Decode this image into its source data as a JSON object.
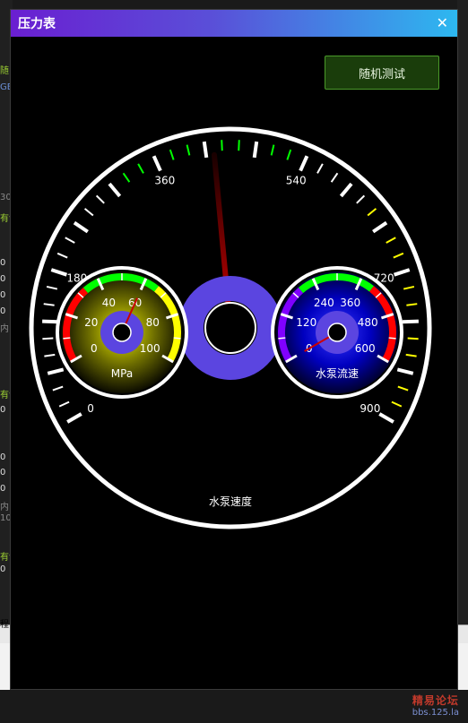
{
  "window": {
    "title": "压力表",
    "close_glyph": "✕"
  },
  "toolbar": {
    "random_test_label": "随机测试"
  },
  "main_gauge": {
    "label": "水泵速度",
    "min": 0,
    "max": 900,
    "value": 430,
    "scale_labels": [
      "0",
      "180",
      "360",
      "540",
      "720",
      "900"
    ]
  },
  "pressure_gauge": {
    "unit": "MPa",
    "min": 0,
    "max": 100,
    "value": 60,
    "scale_labels": [
      "0",
      "20",
      "40",
      "60",
      "80",
      "100"
    ]
  },
  "flow_gauge": {
    "label": "水泵流速",
    "min": 0,
    "max": 600,
    "value": 0,
    "scale_labels": [
      "0",
      "120",
      "240",
      "360",
      "480",
      "600"
    ]
  },
  "colors": {
    "accent": "#5b45e0",
    "low": "#ff0000",
    "mid": "#00ff00",
    "high": "#ffff00",
    "purple": "#8000ff",
    "needle": "#cc0000"
  },
  "background": {
    "left_fragments": [
      "随",
      "GB",
      "30",
      "有色",
      "0",
      "0",
      "0",
      "0",
      "内:",
      "有色",
      "0",
      "0",
      "0",
      "0",
      "内:",
      "10",
      "有色",
      "0",
      "程"
    ],
    "watermark_line1": "精易论坛",
    "watermark_line2": "bbs.125.la"
  }
}
